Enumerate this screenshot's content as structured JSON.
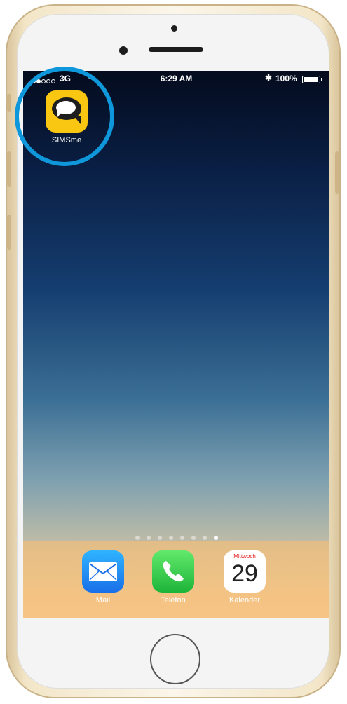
{
  "status_bar": {
    "signal_filled": 2,
    "signal_total": 5,
    "carrier": "3G",
    "time": "6:29 AM",
    "battery_percent": "100%",
    "battery_level": 1.0
  },
  "home_apps": [
    {
      "label": "SIMSme",
      "icon": "simsme-icon",
      "color": "#f9c611",
      "highlighted": true
    }
  ],
  "highlight_color": "#0f97db",
  "page_indicator": {
    "total": 8,
    "active_index": 7
  },
  "dock_apps": [
    {
      "label": "Mail",
      "icon": "mail-icon"
    },
    {
      "label": "Telefon",
      "icon": "phone-icon"
    },
    {
      "label": "Kalender",
      "icon": "calendar-icon",
      "weekday": "Mittwoch",
      "day": "29"
    }
  ]
}
